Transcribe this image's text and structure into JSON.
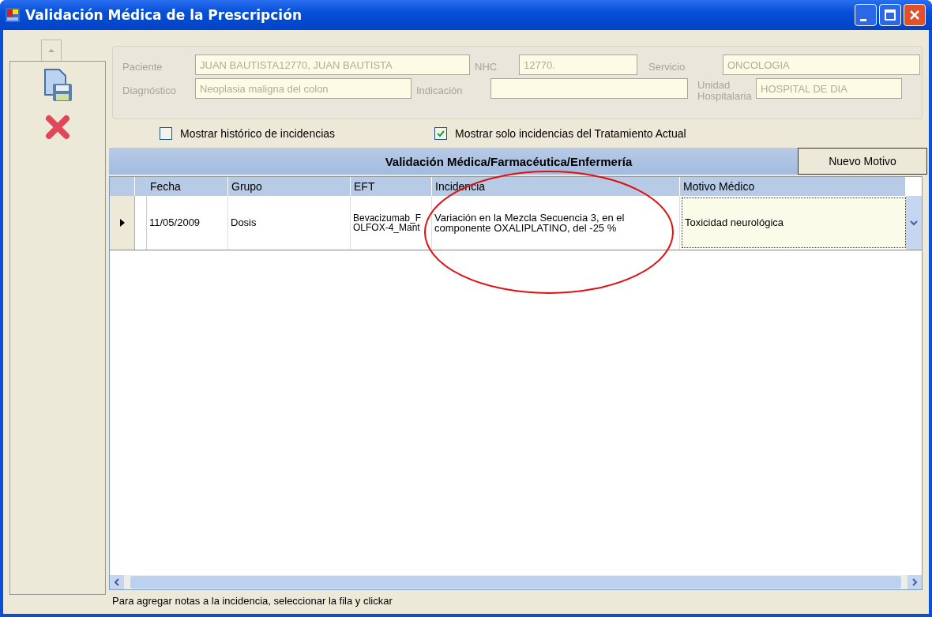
{
  "window": {
    "title": "Validación Médica de la Prescripción"
  },
  "fields_row1": [
    {
      "label": "Paciente",
      "value": "JUAN BAUTISTA12770, JUAN BAUTISTA"
    },
    {
      "label": "NHC",
      "value": "12770."
    },
    {
      "label": "Servicio",
      "value": "ONCOLOGIA"
    }
  ],
  "fields_row2": [
    {
      "label": "Diagnóstico",
      "value": "Neoplasia maligna del colon"
    },
    {
      "label": "Indicación"
    },
    {
      "label": "Unidad Hospitalaria",
      "value": "HOSPITAL DE DIA"
    }
  ],
  "checkboxes": [
    {
      "label": "Mostrar histórico de incidencias",
      "checked": false
    },
    {
      "label": "Mostrar solo incidencias del Tratamiento Actual",
      "checked": true
    }
  ],
  "grid": {
    "title": "Validación Médica/Farmacéutica/Enfermería",
    "button": "Nuevo Motivo",
    "columns": [
      "Fecha",
      "Grupo",
      "EFT",
      "Incidencia",
      "Motivo Médico"
    ],
    "rows": [
      {
        "selected": true,
        "cells": [
          "11/05/2009",
          "Dosis",
          "Bevacizumab_FOLFOX-4_Mant",
          "Variación en la Mezcla Secuencia 3, en el componente OXALIPLATINO, del -25 %",
          "Toxicidad neurológica"
        ]
      }
    ]
  },
  "status_bar": "Para agregar notas a la incidencia, seleccionar la fila y clickar"
}
